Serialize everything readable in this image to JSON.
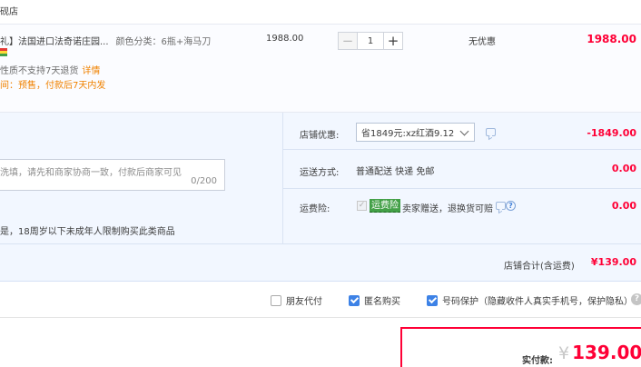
{
  "store": {
    "name": "砚店"
  },
  "item": {
    "title": "礼】法国进口法奇诺庄园...",
    "sku_label": "颜色分类：6瓶+海马刀",
    "return_note": "性质不支持7天退货",
    "return_detail_link": "详情",
    "ship_note": "间：预售，付款后7天内发",
    "unit_price": "1988.00",
    "quantity": "1",
    "minus_symbol": "−",
    "plus_symbol": "+",
    "discount": "无优惠",
    "total": "1988.00",
    "flag_colors": [
      "#e53935",
      "#fdd835",
      "#43a047"
    ]
  },
  "message": {
    "placeholder": "洗填，请先和商家协商一致，付款后商家可见",
    "counter": "0/200"
  },
  "age_note": "是，18周岁以下未成年人限制购买此类商品",
  "store_discount": {
    "label": "店铺优惠:",
    "selected_option": "省1849元:xz红酒9.12",
    "value": "-1849.00"
  },
  "shipping": {
    "label": "运送方式:",
    "method": "普通配送 快递 免邮",
    "value": "0.00"
  },
  "insurance": {
    "label": "运费险:",
    "check_mark": "✓",
    "badge": "运费险",
    "text": "卖家赠送，退换货可赔",
    "value": "0.00",
    "help_symbol": "?"
  },
  "store_total": {
    "label": "店铺合计(含运费)",
    "value": "¥139.00"
  },
  "options": {
    "friend_pay": "朋友代付",
    "anonymous": "匿名购买",
    "phone_protect": "号码保护（隐藏收件人真实手机号，保护隐私）",
    "help_symbol": "?"
  },
  "payment": {
    "label": "实付款:",
    "currency": "¥",
    "amount": "139.00"
  },
  "colors": {
    "price_red": "#ff0036",
    "accent_orange": "#f08200",
    "panel_blue": "#f2f7ff",
    "check_blue": "#3d82e6",
    "badge_green": "#43a047"
  }
}
